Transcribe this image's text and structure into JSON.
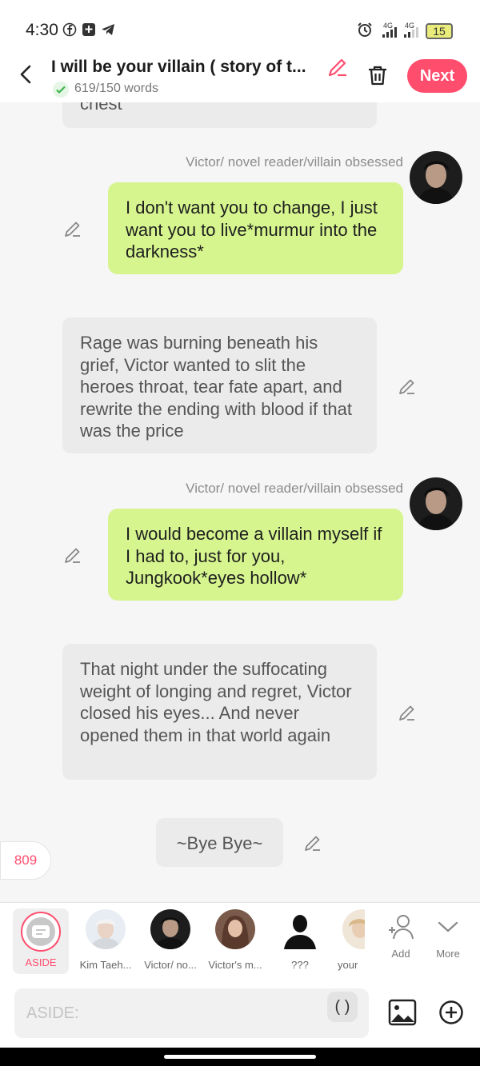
{
  "status_bar": {
    "time": "4:30",
    "network_1": "4G",
    "network_2": "4G",
    "battery": "15"
  },
  "header": {
    "title": "I will be your villain ( story of t...",
    "word_count": "619/150 words",
    "next_label": "Next"
  },
  "chat": {
    "top_bubble_tail": "chest",
    "messages": [
      {
        "speaker": "Victor/ novel reader/villain obsessed",
        "text": "I don't want you to change, I just want you to live*murmur into the darkness*"
      },
      {
        "text": "Rage was burning beneath his grief, Victor wanted to slit the heroes throat, tear fate apart, and rewrite the ending with blood if that was the price"
      },
      {
        "speaker": "Victor/ novel reader/villain obsessed",
        "text": "I would become a villain myself if I had to, just for you, Jungkook*eyes hollow*"
      },
      {
        "text": "That night under the suffocating weight of longing and regret, Victor closed his eyes... And never opened them in that world again"
      },
      {
        "text": "~Bye Bye~"
      }
    ]
  },
  "counter": "809",
  "characters": {
    "aside": "ASIDE",
    "items": [
      "Kim Taeh...",
      "Victor/ no...",
      "Victor's m...",
      "???",
      "your"
    ],
    "add": "Add",
    "more": "More"
  },
  "input": {
    "placeholder": "ASIDE:",
    "paren_button": "( )"
  },
  "colors": {
    "accent": "#ff4d6d",
    "user_bubble": "#d6f58f",
    "narration_bubble": "#ebebeb"
  }
}
